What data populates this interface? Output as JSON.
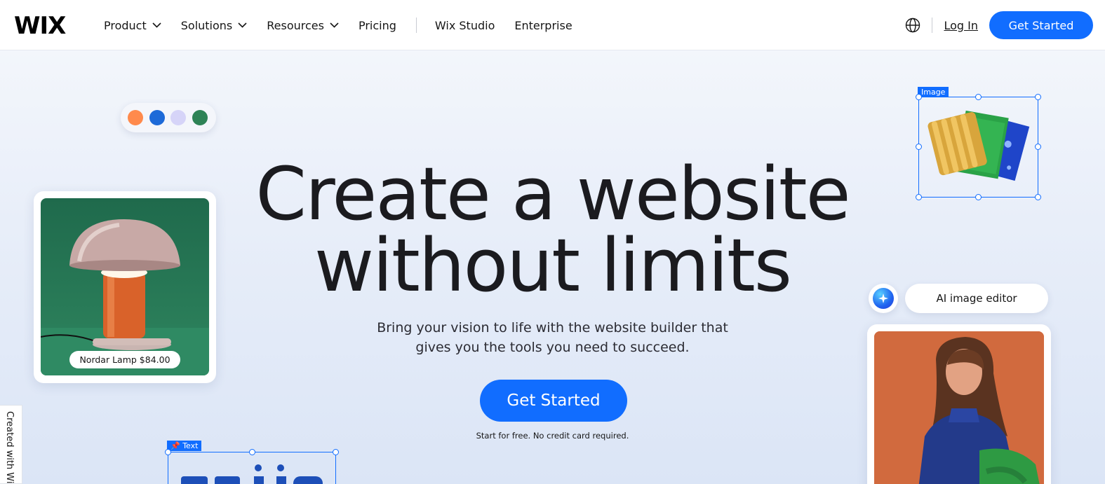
{
  "brand": {
    "logo": "WIX",
    "accent": "#116dff"
  },
  "nav": {
    "items": [
      {
        "label": "Product",
        "has_dropdown": true
      },
      {
        "label": "Solutions",
        "has_dropdown": true
      },
      {
        "label": "Resources",
        "has_dropdown": true
      },
      {
        "label": "Pricing",
        "has_dropdown": false
      }
    ],
    "secondary": [
      {
        "label": "Wix Studio"
      },
      {
        "label": "Enterprise"
      }
    ],
    "login": "Log In",
    "cta": "Get Started",
    "globe_icon": "globe-icon"
  },
  "hero": {
    "headline_line1": "Create a website",
    "headline_line2": "without limits",
    "subtext_line1": "Bring your vision to life with the website builder that",
    "subtext_line2": "gives you the tools you need to succeed.",
    "cta": "Get Started",
    "note": "Start for free. No credit card required."
  },
  "palette": {
    "colors": [
      "#ff8a4c",
      "#1d6ad8",
      "#d6d4f8",
      "#2e8356"
    ]
  },
  "product_card": {
    "label": "Nordar Lamp $84.00"
  },
  "image_selection": {
    "tag": "Image"
  },
  "text_selection": {
    "tag": "Text"
  },
  "ai_editor": {
    "label": "AI image editor"
  },
  "side_tab": {
    "label": "Created with Wix"
  }
}
